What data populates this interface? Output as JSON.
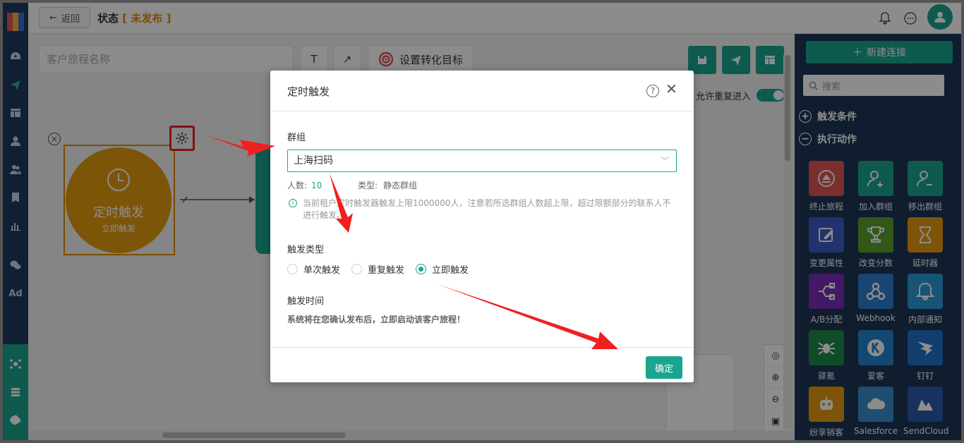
{
  "header": {
    "back_label": "返回",
    "title": "状态",
    "status_text": "未发布"
  },
  "leftnav": {
    "ad_label": "Ad"
  },
  "toolbar": {
    "name_placeholder": "客户旅程名称",
    "text_tool": "T",
    "arrow_tool": "↗",
    "goal_label": "设置转化目标",
    "repeat_entry_label": "允许重复进入"
  },
  "canvas": {
    "trigger_node_title": "定时触发",
    "trigger_node_subtitle": "立即触发"
  },
  "right_panel": {
    "new_connection_label": "新建连接",
    "search_placeholder": "搜索",
    "section_triggers": "触发条件",
    "section_actions": "执行动作",
    "actions": [
      {
        "label": "终止旅程",
        "color": "#e05454",
        "icon": "eject-icon"
      },
      {
        "label": "加入群组",
        "color": "#1aa591",
        "icon": "user-plus-icon"
      },
      {
        "label": "移出群组",
        "color": "#1aa591",
        "icon": "user-minus-icon"
      },
      {
        "label": "变更属性",
        "color": "#3f5cc8",
        "icon": "edit-icon"
      },
      {
        "label": "改变分数",
        "color": "#58a02e",
        "icon": "trophy-icon"
      },
      {
        "label": "延时器",
        "color": "#e69a12",
        "icon": "hourglass-icon"
      },
      {
        "label": "A/B分配",
        "color": "#7a2fb8",
        "icon": "split-icon"
      },
      {
        "label": "Webhook",
        "color": "#2c7fd0",
        "icon": "webhook-icon"
      },
      {
        "label": "内部通知",
        "color": "#2c9ad8",
        "icon": "bell-icon"
      },
      {
        "label": "驿氪",
        "color": "#1d8a48",
        "icon": "spider-icon"
      },
      {
        "label": "爱客",
        "color": "#1f86d0",
        "icon": "k-logo-icon"
      },
      {
        "label": "钉钉",
        "color": "#1e72c8",
        "icon": "dingtalk-icon"
      },
      {
        "label": "纷享销客",
        "color": "#e69a12",
        "icon": "robot-icon"
      },
      {
        "label": "Salesforce",
        "color": "#3a8fd0",
        "icon": "cloud-icon"
      },
      {
        "label": "SendCloud",
        "color": "#2a5ca8",
        "icon": "sendcloud-icon"
      }
    ]
  },
  "modal": {
    "title": "定时触发",
    "group_label": "群组",
    "group_value": "上海扫码",
    "count_label": "人数:",
    "count_value": "10",
    "type_label": "类型:",
    "type_value": "静态群组",
    "info_text": "当前租户定时触发器触发上限1000000人，注意若所选群组人数超上限，超过限额部分的联系人不进行触发。",
    "trigger_type_label": "触发类型",
    "options": [
      {
        "label": "单次触发",
        "selected": false
      },
      {
        "label": "重复触发",
        "selected": false
      },
      {
        "label": "立即触发",
        "selected": true
      }
    ],
    "trigger_time_label": "触发时间",
    "trigger_time_desc": "系统将在您确认发布后，立即启动该客户旅程！",
    "confirm_label": "确定"
  },
  "colors": {
    "accent": "#1aa591",
    "trigger_orange": "#e39c10",
    "nav_dark": "#1e3a5f",
    "annotation_red": "#f02020"
  }
}
